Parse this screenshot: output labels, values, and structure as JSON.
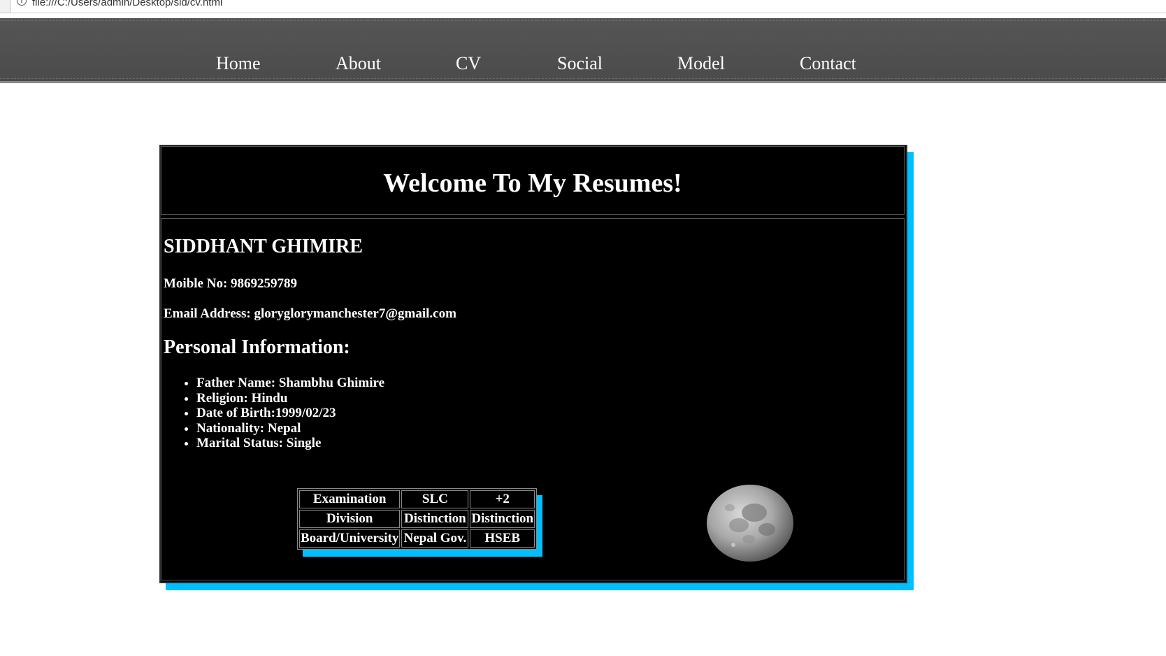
{
  "browser": {
    "url": "file:///C:/Users/admin/Desktop/sid/cv.html"
  },
  "nav": {
    "items": [
      "Home",
      "About",
      "CV",
      "Social",
      "Model",
      "Contact"
    ]
  },
  "resume": {
    "title": "Welcome To My Resumes!",
    "name": "SIDDHANT GHIMIRE",
    "mobile": "Moible No: 9869259789",
    "email": "Email Address: glorygloryman chester7@gmail.com",
    "personal_title": "Personal Information:",
    "personal_items": [
      "Father Name: Shambhu Ghimire",
      "Religion: Hindu",
      "Date of Birth:1999/02/23",
      "Nationality: Nepal",
      "Marital Status: Single"
    ],
    "table": {
      "rows": [
        [
          "Examination",
          "SLC",
          "+2"
        ],
        [
          "Division",
          "Distinction",
          "Distinction"
        ],
        [
          "Board/University",
          "Nepal Gov.",
          "HSEB"
        ]
      ]
    }
  },
  "colors": {
    "accent": "#00bfff",
    "panel": "#000000",
    "navbar": "#4f4f4f"
  }
}
